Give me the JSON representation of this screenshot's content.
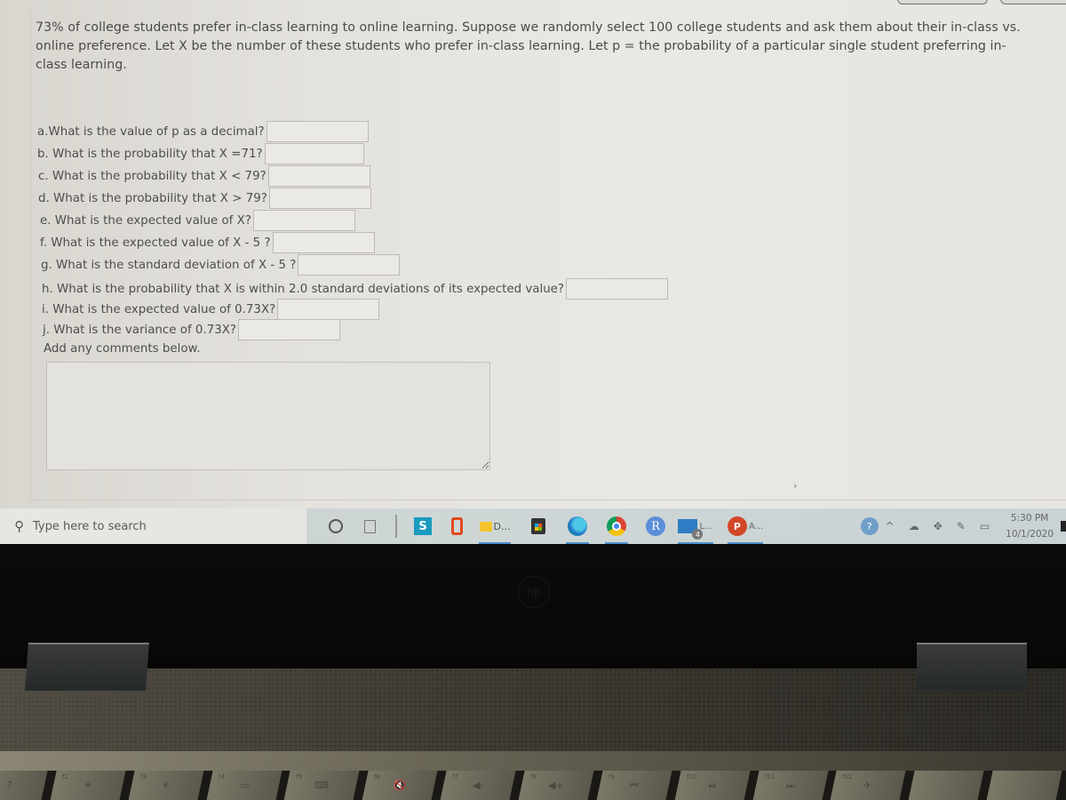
{
  "problem": {
    "intro_line1": "73% of college students prefer in-class learning to online learning. Suppose we randomly select 100 college students and ask them about their in-class vs.",
    "intro_line2": "online preference. Let X be the number of these students who prefer in-class learning. Let p = the probability of a particular single student preferring in-",
    "intro_line3": "class learning."
  },
  "questions": [
    {
      "label": "a.What is the value of p as a decimal?",
      "value": ""
    },
    {
      "label": "b. What is the probability that X =71?",
      "value": ""
    },
    {
      "label": "c. What is the probability that X < 79?",
      "value": ""
    },
    {
      "label": "d. What is the probability that X > 79?",
      "value": ""
    },
    {
      "label": "e. What is the expected value of X?",
      "value": ""
    },
    {
      "label": "f. What is the expected value of X - 5 ?",
      "value": ""
    },
    {
      "label": "g. What is the standard deviation of X - 5 ?",
      "value": ""
    },
    {
      "label": "h. What is the probability that X is within 2.0 standard deviations of its expected value?",
      "value": ""
    },
    {
      "label": "i. What is the expected value of 0.73X?",
      "value": ""
    },
    {
      "label": "j. What is the variance of 0.73X?",
      "value": ""
    }
  ],
  "comments": {
    "label": "Add any comments below.",
    "value": ""
  },
  "taskbar": {
    "search_placeholder": "Type here to search",
    "apps": [
      {
        "name": "cortana",
        "label": ""
      },
      {
        "name": "task-view",
        "label": ""
      },
      {
        "name": "app-s",
        "label": "S"
      },
      {
        "name": "office",
        "label": ""
      },
      {
        "name": "file-explorer",
        "label": "D..."
      },
      {
        "name": "store",
        "label": ""
      },
      {
        "name": "edge",
        "label": ""
      },
      {
        "name": "chrome",
        "label": ""
      },
      {
        "name": "r-app",
        "label": "R"
      },
      {
        "name": "mail",
        "label": "L...",
        "badge": "4"
      },
      {
        "name": "powerpoint",
        "label": "A...",
        "icon_text": "P"
      }
    ],
    "clock_time": "5:30 PM",
    "clock_date": "10/1/2020"
  },
  "keyboard": {
    "keys": [
      {
        "fn": "",
        "glyph": "?"
      },
      {
        "fn": "f2",
        "glyph": "☀"
      },
      {
        "fn": "f3",
        "glyph": "✳"
      },
      {
        "fn": "f4",
        "glyph": "▭"
      },
      {
        "fn": "f5",
        "glyph": "⌨"
      },
      {
        "fn": "f6",
        "glyph": "🔇"
      },
      {
        "fn": "f7",
        "glyph": "◀-"
      },
      {
        "fn": "f8",
        "glyph": "◀+"
      },
      {
        "fn": "f9",
        "glyph": "⏮"
      },
      {
        "fn": "f10",
        "glyph": "⏯"
      },
      {
        "fn": "f11",
        "glyph": "⏭"
      },
      {
        "fn": "f12",
        "glyph": "✈"
      },
      {
        "fn": "",
        "glyph": ""
      },
      {
        "fn": "",
        "glyph": ""
      }
    ]
  }
}
